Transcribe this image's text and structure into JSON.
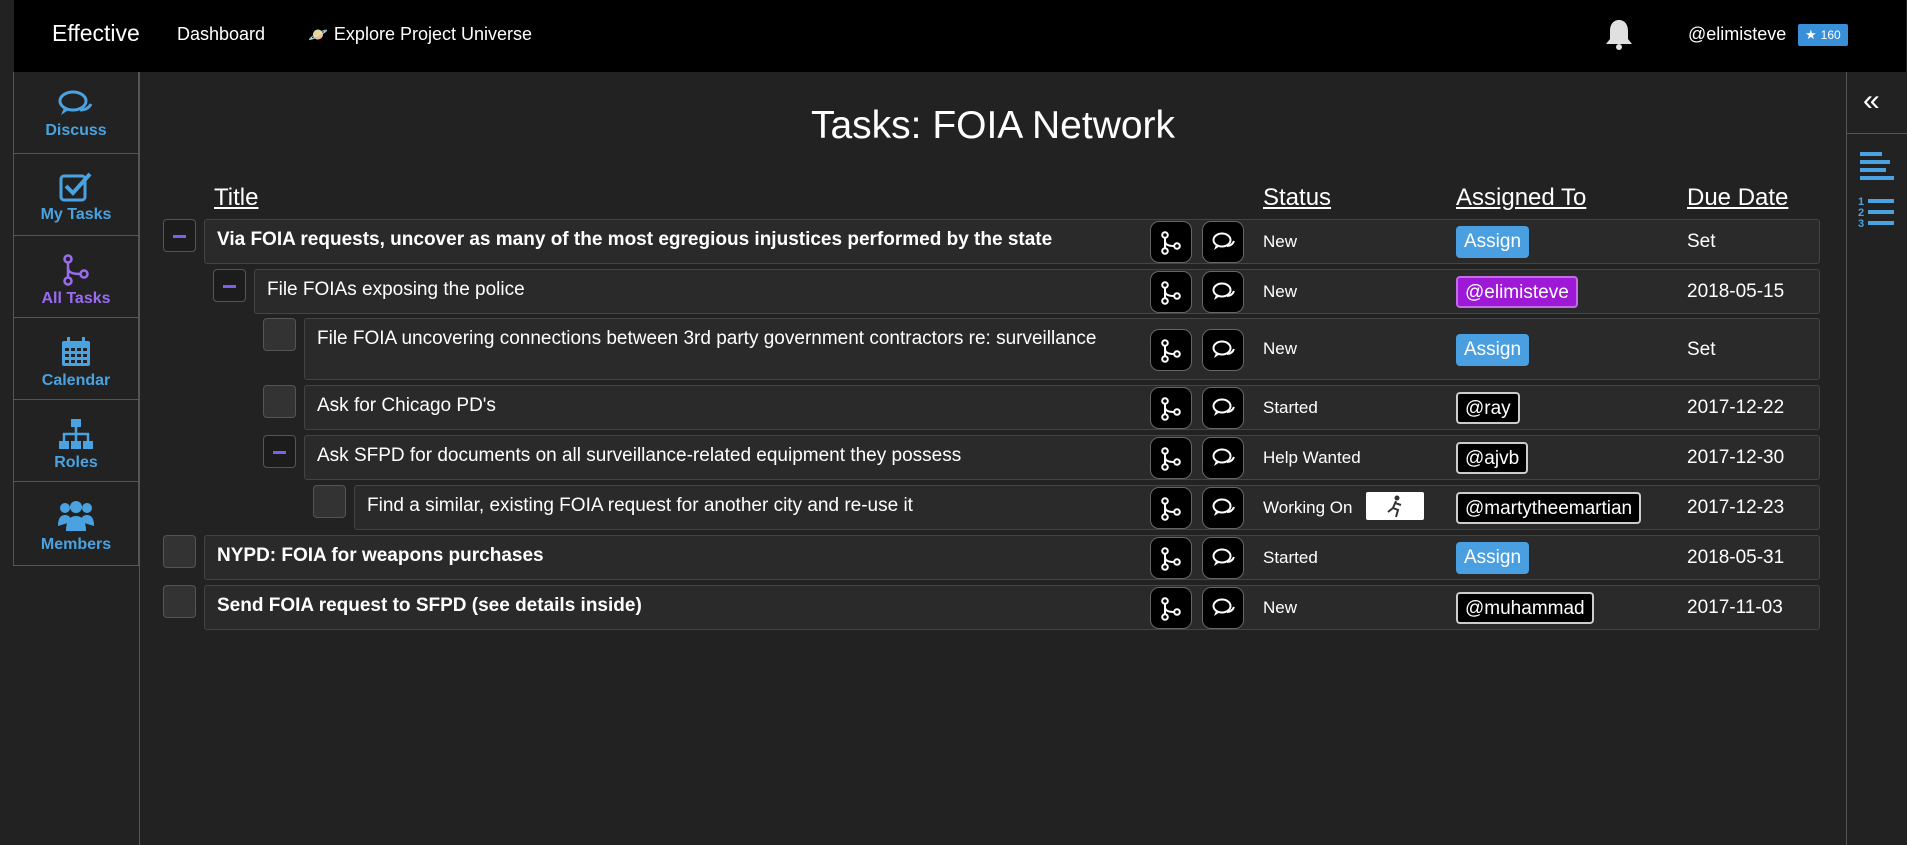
{
  "topbar": {
    "brand": "Effective",
    "dashboard": "Dashboard",
    "explore": "Explore Project Universe",
    "explore_icon": "saturn-icon",
    "bell_icon": "bell-icon",
    "username": "@elimisteve",
    "karma": "160"
  },
  "leftnav": {
    "items": [
      {
        "label": "Discuss",
        "icon": "chat-icon"
      },
      {
        "label": "My Tasks",
        "icon": "checkbox-icon"
      },
      {
        "label": "All Tasks",
        "icon": "tree-icon"
      },
      {
        "label": "Calendar",
        "icon": "calendar-icon"
      },
      {
        "label": "Roles",
        "icon": "org-chart-icon"
      },
      {
        "label": "Members",
        "icon": "users-icon"
      }
    ]
  },
  "page": {
    "title": "Tasks: FOIA Network"
  },
  "columns": {
    "title": "Title",
    "status": "Status",
    "assigned": "Assigned To",
    "due": "Due Date"
  },
  "tasks": [
    {
      "title": "Via FOIA requests, uncover as many of the most egregious injustices performed by the state",
      "status": "New",
      "assignee": "Assign",
      "due": "Set"
    },
    {
      "title": "File FOIAs exposing the police",
      "status": "New",
      "assignee": "@elimisteve",
      "due": "2018-05-15"
    },
    {
      "title": "File FOIA uncovering connections between 3rd party government contractors re: surveillance",
      "status": "New",
      "assignee": "Assign",
      "due": "Set"
    },
    {
      "title": "Ask for Chicago PD's",
      "status": "Started",
      "assignee": "@ray",
      "due": "2017-12-22"
    },
    {
      "title": "Ask SFPD for documents on all surveillance-related equipment they possess",
      "status": "Help Wanted",
      "assignee": "@ajvb",
      "due": "2017-12-30"
    },
    {
      "title": "Find a similar, existing FOIA request for another city and re-use it",
      "status": "Working On",
      "assignee": "@martytheemartian",
      "due": "2017-12-23"
    },
    {
      "title": "NYPD: FOIA for weapons purchases",
      "status": "Started",
      "assignee": "Assign",
      "due": "2018-05-31"
    },
    {
      "title": "Send FOIA request to SFPD (see details inside)",
      "status": "New",
      "assignee": "@muhammad",
      "due": "2017-11-03"
    }
  ],
  "colors": {
    "accent_blue": "#4a9fe0",
    "accent_purple": "#9a6cf0",
    "self_tag": "#9d19d6"
  }
}
